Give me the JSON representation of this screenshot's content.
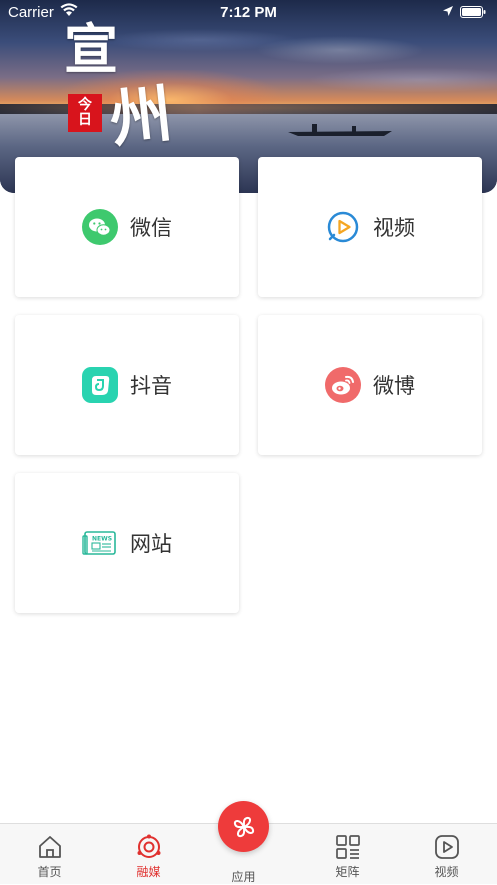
{
  "status_bar": {
    "carrier": "Carrier",
    "time": "7:12 PM"
  },
  "hero": {
    "logo_text_1": "宣",
    "logo_text_2": "州",
    "seal_text_1": "今",
    "seal_text_2": "日"
  },
  "cards": [
    {
      "label": "微信",
      "icon": "wechat-icon",
      "color": "#3ec96e"
    },
    {
      "label": "视频",
      "icon": "video-play-icon",
      "color": "#2a8ad6"
    },
    {
      "label": "抖音",
      "icon": "douyin-icon",
      "color": "#29d3b0"
    },
    {
      "label": "微博",
      "icon": "weibo-icon",
      "color": "#f06a6a"
    },
    {
      "label": "网站",
      "icon": "news-icon",
      "color": "#2ab89a"
    }
  ],
  "news_icon_text": "NEWS",
  "tabbar": {
    "items": [
      {
        "label": "首页",
        "icon": "home-icon"
      },
      {
        "label": "融媒",
        "icon": "media-icon",
        "active": true
      },
      {
        "label": "应用",
        "icon": "apps-icon"
      },
      {
        "label": "矩阵",
        "icon": "matrix-icon"
      },
      {
        "label": "视频",
        "icon": "video-icon"
      }
    ],
    "active_color": "#e0312f",
    "center_button_color": "#ee3b3b"
  }
}
